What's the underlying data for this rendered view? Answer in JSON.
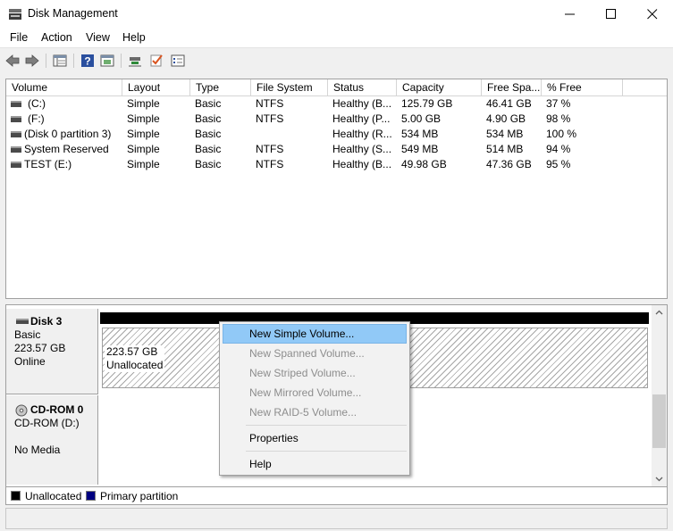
{
  "window": {
    "title": "Disk Management"
  },
  "menu": [
    "File",
    "Action",
    "View",
    "Help"
  ],
  "toolbar": {
    "icons": [
      "back-icon",
      "forward-icon",
      "disk-list-icon",
      "help-icon",
      "console-icon",
      "connect-icon",
      "check-icon",
      "properties-list-icon"
    ]
  },
  "volumes": {
    "columns": [
      "Volume",
      "Layout",
      "Type",
      "File System",
      "Status",
      "Capacity",
      "Free Spa...",
      "% Free"
    ],
    "rows": [
      {
        "volume": "(C:)",
        "layout": "Simple",
        "type": "Basic",
        "fs": "NTFS",
        "status": "Healthy (B...",
        "capacity": "125.79 GB",
        "free": "46.41 GB",
        "pct": "37 %"
      },
      {
        "volume": "(F:)",
        "layout": "Simple",
        "type": "Basic",
        "fs": "NTFS",
        "status": "Healthy (P...",
        "capacity": "5.00 GB",
        "free": "4.90 GB",
        "pct": "98 %"
      },
      {
        "volume": "(Disk 0 partition 3)",
        "layout": "Simple",
        "type": "Basic",
        "fs": "",
        "status": "Healthy (R...",
        "capacity": "534 MB",
        "free": "534 MB",
        "pct": "100 %"
      },
      {
        "volume": "System Reserved",
        "layout": "Simple",
        "type": "Basic",
        "fs": "NTFS",
        "status": "Healthy (S...",
        "capacity": "549 MB",
        "free": "514 MB",
        "pct": "94 %"
      },
      {
        "volume": "TEST (E:)",
        "layout": "Simple",
        "type": "Basic",
        "fs": "NTFS",
        "status": "Healthy (B...",
        "capacity": "49.98 GB",
        "free": "47.36 GB",
        "pct": "95 %"
      }
    ]
  },
  "disks": [
    {
      "name": "Disk 3",
      "kind": "Basic",
      "size": "223.57 GB",
      "state": "Online",
      "partition": {
        "size": "223.57 GB",
        "label": "Unallocated"
      }
    },
    {
      "name": "CD-ROM 0",
      "kind": "CD-ROM (D:)",
      "state": "No Media"
    }
  ],
  "legend": [
    {
      "label": "Unallocated",
      "color": "#000000"
    },
    {
      "label": "Primary partition",
      "color": "#000080"
    }
  ],
  "context_menu": {
    "items": [
      {
        "label": "New Simple Volume...",
        "state": "highlighted"
      },
      {
        "label": "New Spanned Volume...",
        "state": "disabled"
      },
      {
        "label": "New Striped Volume...",
        "state": "disabled"
      },
      {
        "label": "New Mirrored Volume...",
        "state": "disabled"
      },
      {
        "label": "New RAID-5 Volume...",
        "state": "disabled"
      },
      {
        "label": "Properties",
        "state": "enabled"
      },
      {
        "label": "Help",
        "state": "enabled"
      }
    ]
  }
}
